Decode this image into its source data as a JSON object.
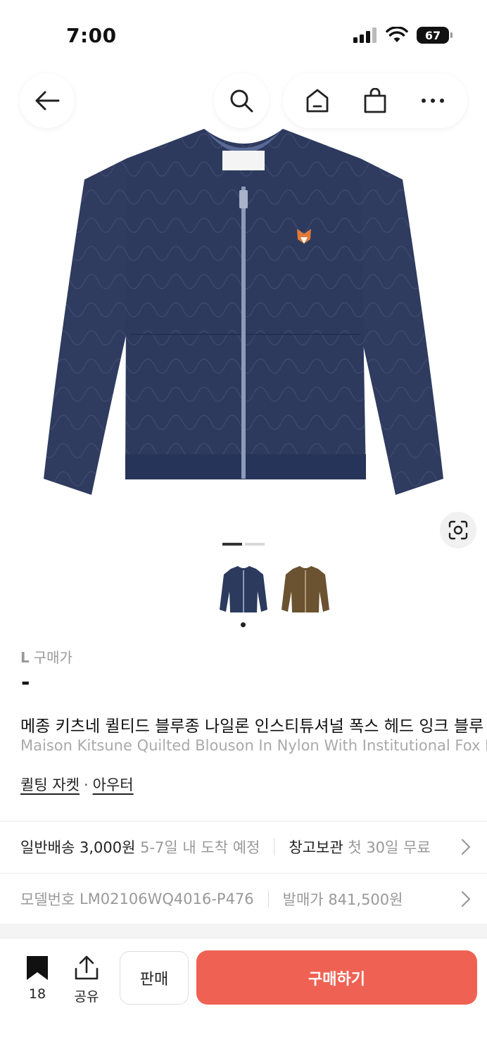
{
  "status_bar": {
    "time": "7:00",
    "battery": "67"
  },
  "product": {
    "size": "L",
    "price_label": "구매가",
    "price": "-",
    "title_ko": "메종 키츠네 퀼티드 블루종 나일론 인스티튜셔널 폭스 헤드 잉크 블루",
    "title_en": "Maison Kitsune Quilted Blouson In Nylon With Institutional Fox Head Ink Blue",
    "category_1": "퀼팅 자켓",
    "category_sep": "·",
    "category_2": "아우터",
    "image_count": 2,
    "current_image": 1,
    "colors": {
      "thumb_1": "#2c3a5e",
      "thumb_2": "#6b5230"
    }
  },
  "shipping": {
    "label": "일반배송",
    "price": "3,000원",
    "eta": "5-7일 내 도착 예정",
    "storage_label": "창고보관",
    "storage_info": "첫 30일 무료"
  },
  "details": {
    "model_label": "모델번호",
    "model_value": "LM02106WQ4016-P476",
    "release_label": "발매가",
    "release_value": "841,500원"
  },
  "bottom": {
    "bookmark_count": "18",
    "share_label": "공유",
    "sell_label": "판매",
    "buy_label": "구매하기",
    "buy_color": "#ef6253"
  }
}
